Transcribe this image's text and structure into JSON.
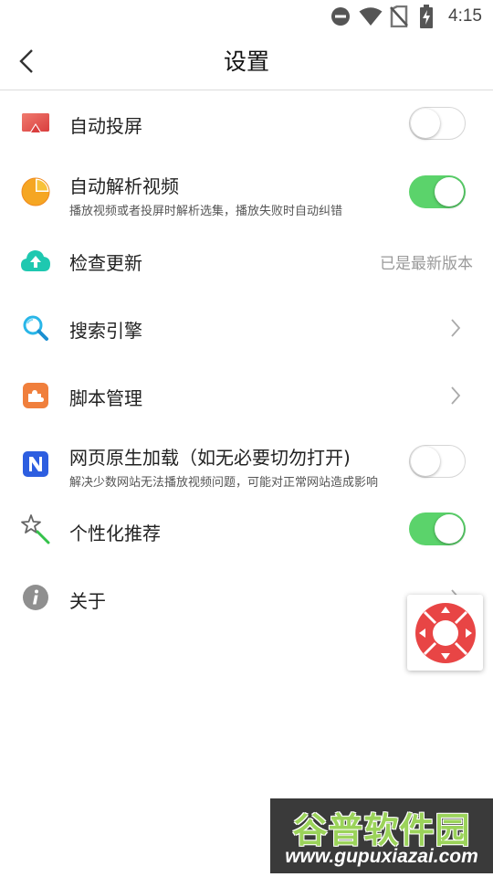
{
  "status_bar": {
    "time": "4:15",
    "icons": [
      "do-not-disturb-icon",
      "wifi-icon",
      "no-sim-icon",
      "battery-charging-icon"
    ]
  },
  "header": {
    "back_icon": "chevron-left-icon",
    "title": "设置"
  },
  "settings": [
    {
      "id": "auto-cast",
      "icon": "screen-cast-icon",
      "title": "自动投屏",
      "control": "toggle",
      "on": false
    },
    {
      "id": "auto-parse-video",
      "icon": "pie-chart-icon",
      "title": "自动解析视频",
      "subtitle": "播放视频或者投屏时解析选集，播放失败时自动纠错",
      "control": "toggle",
      "on": true
    },
    {
      "id": "check-update",
      "icon": "cloud-upload-icon",
      "title": "检查更新",
      "value": "已是最新版本"
    },
    {
      "id": "search-engine",
      "icon": "search-icon",
      "title": "搜索引擎",
      "control": "chevron"
    },
    {
      "id": "script-manage",
      "icon": "puzzle-icon",
      "title": "脚本管理",
      "control": "chevron"
    },
    {
      "id": "native-load",
      "icon": "n-logo-icon",
      "title": "网页原生加载（如无必要切勿打开)",
      "subtitle": "解决少数网站无法播放视频问题，可能对正常网站造成影响",
      "control": "toggle",
      "on": false
    },
    {
      "id": "personalized",
      "icon": "magic-wand-icon",
      "title": "个性化推荐",
      "control": "toggle",
      "on": true
    },
    {
      "id": "about",
      "icon": "info-icon",
      "title": "关于",
      "control": "chevron"
    }
  ],
  "floating_widget": {
    "icon": "direction-pad-icon"
  },
  "watermark": {
    "title": "谷普软件园",
    "url": "www.gupuxiazai.com"
  },
  "colors": {
    "toggle_on": "#5bd36b",
    "divider": "#dcdcdc",
    "value_text": "#999999"
  }
}
